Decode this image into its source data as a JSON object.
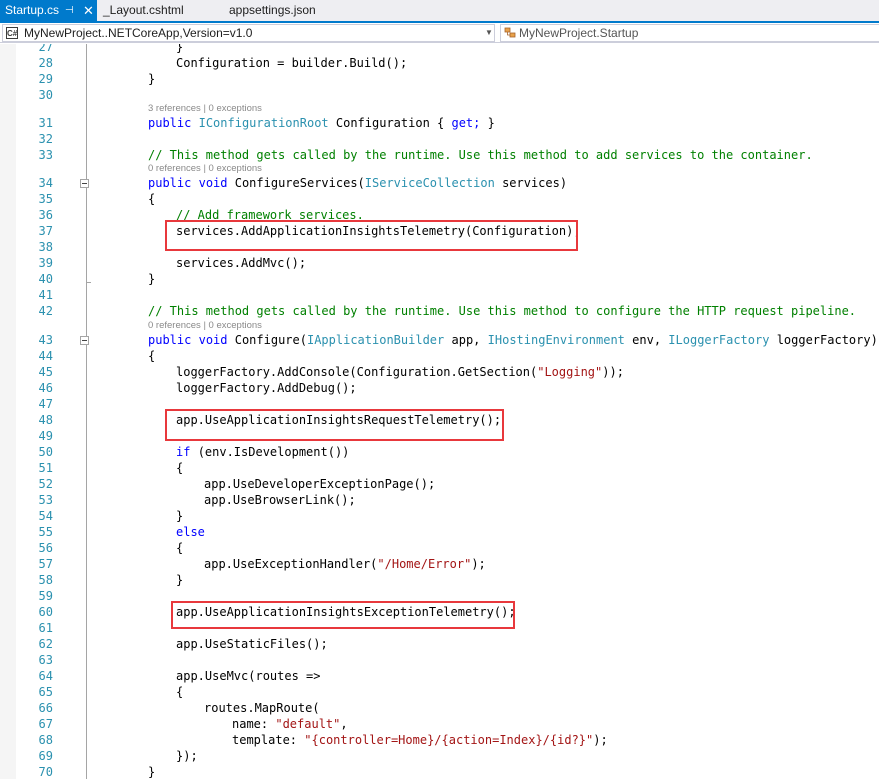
{
  "tabs": [
    {
      "label": "Startup.cs",
      "active": true,
      "pinned": true
    },
    {
      "label": "_Layout.cshtml",
      "active": false
    },
    {
      "label": "appsettings.json",
      "active": false
    }
  ],
  "navigation": {
    "project_combo": {
      "icon": "C#",
      "value": "MyNewProject..NETCoreApp,Version=v1.0"
    },
    "type_combo": {
      "icon": "class-icon",
      "value": "MyNewProject.Startup"
    }
  },
  "colors": {
    "accent": "#007acc",
    "keyword": "#0000ff",
    "type": "#2b91af",
    "comment": "#008000",
    "string": "#a31515",
    "highlight_box": "#e8383c"
  },
  "editor": {
    "lines": [
      {
        "num": "27",
        "text": "}"
      },
      {
        "num": "28",
        "text": "Configuration = builder.Build();"
      },
      {
        "num": "29",
        "text": "}"
      },
      {
        "num": "30",
        "text": ""
      },
      {
        "lens": "3 references | 0 exceptions"
      },
      {
        "num": "31",
        "kw1": "public",
        "type": "IConfigurationRoot",
        "text": "Configuration {",
        "kw2": "get;",
        "text2": "}"
      },
      {
        "num": "32",
        "text": ""
      },
      {
        "num": "33",
        "comment": "// This method gets called by the runtime. Use this method to add services to the container."
      },
      {
        "lens": "0 references | 0 exceptions"
      },
      {
        "num": "34",
        "kw1": "public",
        "kw2": "void",
        "text": "ConfigureServices(",
        "type": "IServiceCollection",
        "text2": "services)"
      },
      {
        "num": "35",
        "text": "{"
      },
      {
        "num": "36",
        "comment": "// Add framework services."
      },
      {
        "num": "37",
        "text": "services.AddApplicationInsightsTelemetry(Configuration);"
      },
      {
        "num": "38",
        "text": ""
      },
      {
        "num": "39",
        "text": "services.AddMvc();"
      },
      {
        "num": "40",
        "text": "}"
      },
      {
        "num": "41",
        "text": ""
      },
      {
        "num": "42",
        "comment": "// This method gets called by the runtime. Use this method to configure the HTTP request pipeline."
      },
      {
        "lens": "0 references | 0 exceptions"
      },
      {
        "num": "43",
        "kw1": "public",
        "kw2": "void",
        "text": "Configure(",
        "type1": "IApplicationBuilder",
        "text2": "app,",
        "type2": "IHostingEnvironment",
        "text3": "env,",
        "type3": "ILoggerFactory",
        "text4": "loggerFactory)"
      },
      {
        "num": "44",
        "text": "{"
      },
      {
        "num": "45",
        "text": "loggerFactory.AddConsole(Configuration.GetSection(",
        "string": "\"Logging\"",
        "text2": "));"
      },
      {
        "num": "46",
        "text": "loggerFactory.AddDebug();"
      },
      {
        "num": "47",
        "text": ""
      },
      {
        "num": "48",
        "text": "app.UseApplicationInsightsRequestTelemetry();"
      },
      {
        "num": "49",
        "text": ""
      },
      {
        "num": "50",
        "kw1": "if",
        "text": "(env.IsDevelopment())"
      },
      {
        "num": "51",
        "text": "{"
      },
      {
        "num": "52",
        "text": "app.UseDeveloperExceptionPage();"
      },
      {
        "num": "53",
        "text": "app.UseBrowserLink();"
      },
      {
        "num": "54",
        "text": "}"
      },
      {
        "num": "55",
        "kw1": "else"
      },
      {
        "num": "56",
        "text": "{"
      },
      {
        "num": "57",
        "text": "app.UseExceptionHandler(",
        "string": "\"/Home/Error\"",
        "text2": ");"
      },
      {
        "num": "58",
        "text": "}"
      },
      {
        "num": "59",
        "text": ""
      },
      {
        "num": "60",
        "text": "app.UseApplicationInsightsExceptionTelemetry();"
      },
      {
        "num": "61",
        "text": ""
      },
      {
        "num": "62",
        "text": "app.UseStaticFiles();"
      },
      {
        "num": "63",
        "text": ""
      },
      {
        "num": "64",
        "text": "app.UseMvc(routes =>"
      },
      {
        "num": "65",
        "text": "{"
      },
      {
        "num": "66",
        "text": "routes.MapRoute("
      },
      {
        "num": "67",
        "text": "name:",
        "string": "\"default\"",
        "text2": ","
      },
      {
        "num": "68",
        "text": "template:",
        "string": "\"{controller=Home}/{action=Index}/{id?}\"",
        "text2": ");"
      },
      {
        "num": "69",
        "text": "});"
      },
      {
        "num": "70",
        "text": "}"
      }
    ]
  }
}
